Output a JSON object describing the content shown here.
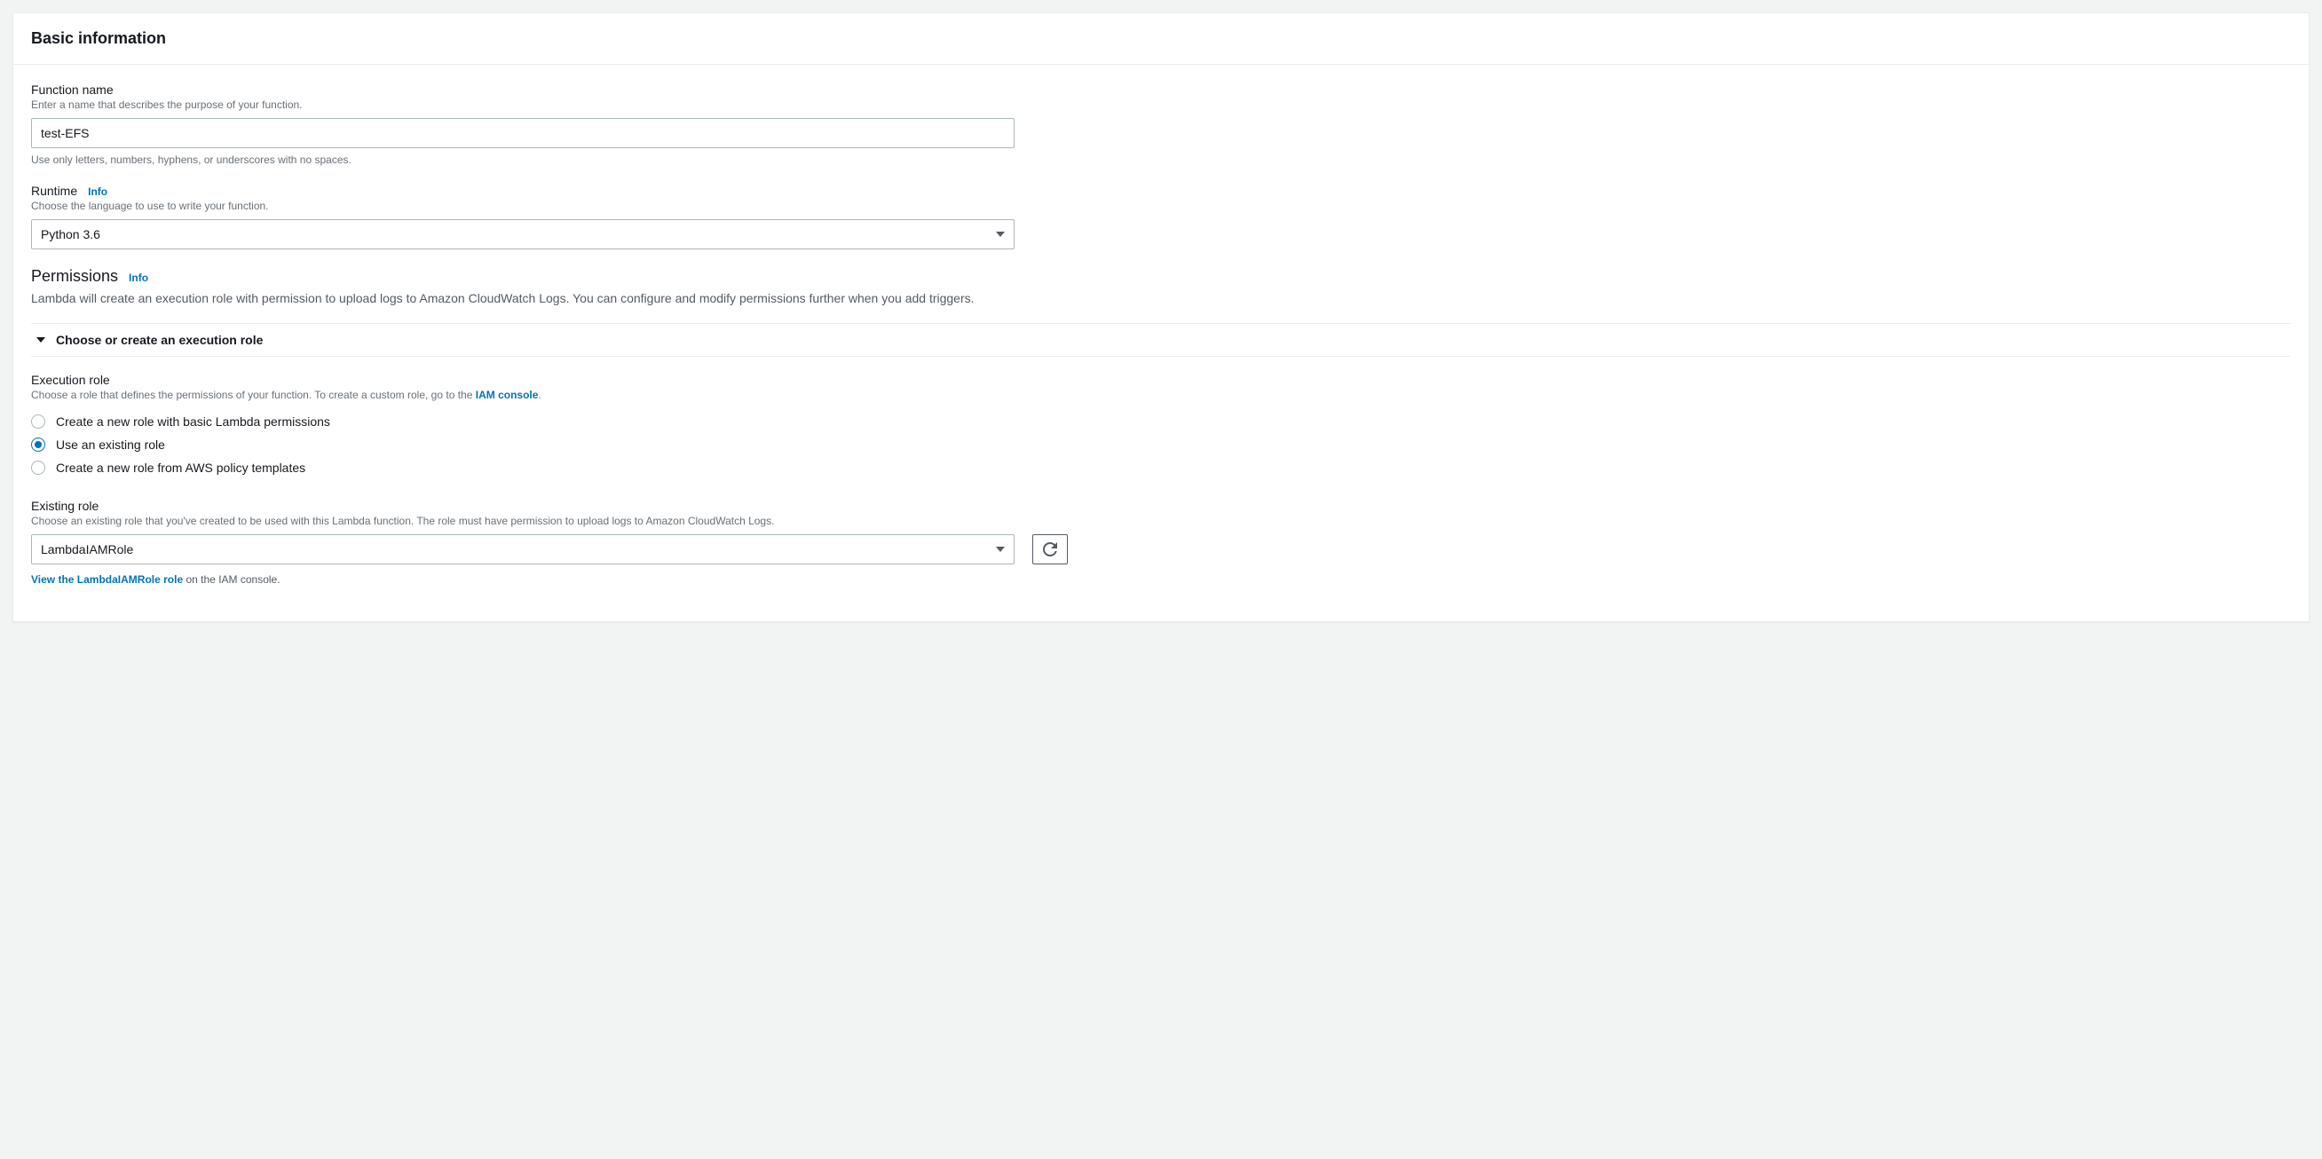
{
  "panel": {
    "title": "Basic information"
  },
  "functionName": {
    "label": "Function name",
    "hint": "Enter a name that describes the purpose of your function.",
    "value": "test-EFS",
    "helper": "Use only letters, numbers, hyphens, or underscores with no spaces."
  },
  "runtime": {
    "label": "Runtime",
    "info": "Info",
    "hint": "Choose the language to use to write your function.",
    "selected": "Python 3.6"
  },
  "permissions": {
    "heading": "Permissions",
    "info": "Info",
    "description": "Lambda will create an execution role with permission to upload logs to Amazon CloudWatch Logs. You can configure and modify permissions further when you add triggers."
  },
  "expander": {
    "label": "Choose or create an execution role"
  },
  "executionRole": {
    "label": "Execution role",
    "hintPrefix": "Choose a role that defines the permissions of your function. To create a custom role, go to the ",
    "hintLink": "IAM console",
    "hintSuffix": ".",
    "options": [
      "Create a new role with basic Lambda permissions",
      "Use an existing role",
      "Create a new role from AWS policy templates"
    ],
    "selectedIndex": 1
  },
  "existingRole": {
    "label": "Existing role",
    "hint": "Choose an existing role that you've created to be used with this Lambda function. The role must have permission to upload logs to Amazon CloudWatch Logs.",
    "selected": "LambdaIAMRole",
    "viewLink": "View the LambdaIAMRole role",
    "viewSuffix": " on the IAM console."
  }
}
